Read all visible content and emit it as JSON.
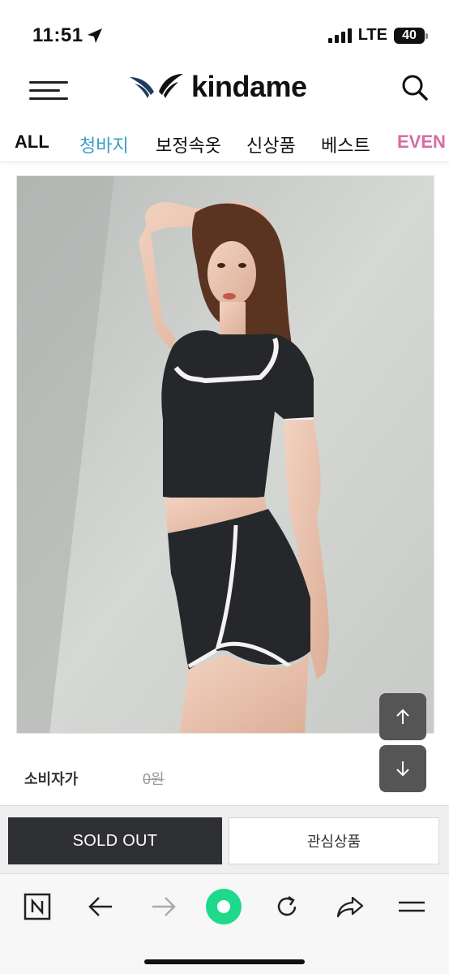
{
  "status_bar": {
    "time": "11:51",
    "network": "LTE",
    "battery": "40"
  },
  "header": {
    "logo_text": "kindame"
  },
  "categories": [
    {
      "label": "ALL",
      "color": "#111111"
    },
    {
      "label": "청바지",
      "color": "#3a9ec7"
    },
    {
      "label": "보정속옷",
      "color": "#111111"
    },
    {
      "label": "신상품",
      "color": "#111111"
    },
    {
      "label": "베스트",
      "color": "#111111"
    },
    {
      "label": "EVEN",
      "color": "#d96aa5"
    }
  ],
  "product": {
    "price_label": "소비자가",
    "price_value": "0원"
  },
  "actions": {
    "sold_out_label": "SOLD OUT",
    "wishlist_label": "관심상품"
  },
  "colors": {
    "accent_blue": "#3a9ec7",
    "accent_pink": "#d96aa5",
    "sold_out_bg": "#2f3033",
    "browser_green": "#1ed98a"
  },
  "browser_icons": [
    "naver-n-icon",
    "back-arrow-icon",
    "forward-arrow-icon",
    "green-home-icon",
    "reload-icon",
    "share-icon",
    "menu-icon"
  ]
}
